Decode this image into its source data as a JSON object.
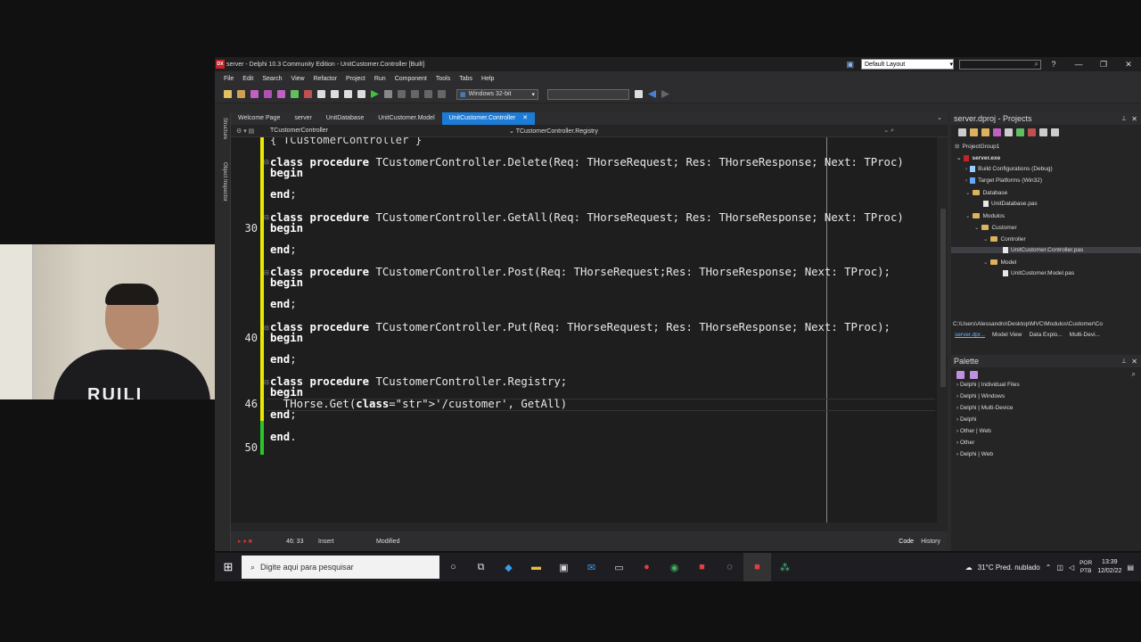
{
  "webcam": {
    "shirt_text": "RUILI"
  },
  "window": {
    "title": "server - Delphi 10.3 Community Edition - UnitCustomer.Controller [Built]",
    "app_icon": "DX",
    "layout_select": "Default Layout",
    "help": "?",
    "minimize": "—",
    "restore": "❐",
    "close": "✕"
  },
  "menu": [
    "File",
    "Edit",
    "Search",
    "View",
    "Refactor",
    "Project",
    "Run",
    "Component",
    "Tools",
    "Tabs",
    "Help"
  ],
  "toolbar": {
    "platform": "Windows 32-bit"
  },
  "side_labels": {
    "structure": "Structure",
    "object_inspector": "Object Inspector"
  },
  "editor": {
    "tabs": [
      "Welcome Page",
      "server",
      "UnitDatabase",
      "UnitCustomer.Model",
      "UnitCustomer.Controller"
    ],
    "active_tab_close": "✕",
    "nav_class": "TCustomerController",
    "nav_method": "TCustomerController.Registry",
    "line_numbers": [
      {
        "n": "30",
        "row": 4
      },
      {
        "n": "40",
        "row": 9
      },
      {
        "n": "46",
        "row": 12
      },
      {
        "n": "50",
        "row": 14
      }
    ],
    "lines": [
      "{ TCustomerController }",
      "class procedure TCustomerController.Delete(Req: THorseRequest; Res: THorseResponse; Next: TProc)",
      "begin",
      "end;",
      "class procedure TCustomerController.GetAll(Req: THorseRequest; Res: THorseResponse; Next: TProc)",
      "begin",
      "end;",
      "class procedure TCustomerController.Post(Req: THorseRequest;Res: THorseResponse; Next: TProc);",
      "begin",
      "end;",
      "class procedure TCustomerController.Put(Req: THorseRequest; Res: THorseResponse; Next: TProc);",
      "begin",
      "end;",
      "class procedure TCustomerController.Registry;",
      "begin",
      "  THorse.Get('/customer', GetAll)",
      "end;",
      "end."
    ]
  },
  "status": {
    "position": "46: 33",
    "mode": "Insert",
    "state": "Modified",
    "code_tab": "Code",
    "history_tab": "History"
  },
  "projects": {
    "title": "server.dproj - Projects",
    "pin": "📌",
    "close": "✕",
    "tree": [
      {
        "label": "ProjectGroup1"
      },
      {
        "label": "server.exe"
      },
      {
        "label": "Build Configurations (Debug)"
      },
      {
        "label": "Target Platforms (Win32)"
      },
      {
        "label": "Database"
      },
      {
        "label": "UnitDatabase.pas"
      },
      {
        "label": "Modulos"
      },
      {
        "label": "Customer"
      },
      {
        "label": "Controller"
      },
      {
        "label": "UnitCustomer.Controller.pas"
      },
      {
        "label": "Model"
      },
      {
        "label": "UnitCustomer.Model.pas"
      }
    ],
    "path": "C:\\Users\\Alessandro\\Desktop\\MVC\\Modulos\\Customer\\Co",
    "bottom_tabs": [
      "server.dpr...",
      "Model View",
      "Data Explo...",
      "Multi-Devi..."
    ]
  },
  "palette": {
    "title": "Palette",
    "items": [
      "Delphi | Individual Files",
      "Delphi | Windows",
      "Delphi | Multi-Device",
      "Delphi",
      "Other | Web",
      "Other",
      "Delphi | Web"
    ]
  },
  "taskbar": {
    "search_placeholder": "Digite aqui para pesquisar",
    "weather": "31°C  Pred. nublado",
    "lang1": "POR",
    "lang2": "PTB",
    "time": "13:39",
    "date": "12/02/22"
  },
  "colors": {
    "accent": "#1c7bd6",
    "change_bar": "#e8e800",
    "saved_bar": "#2bc42b"
  }
}
